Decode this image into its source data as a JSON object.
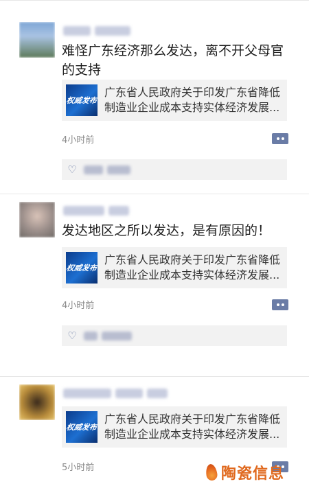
{
  "posts": [
    {
      "text": "难怪广东经济那么发达，离不开父母官的支持",
      "link": {
        "thumb_text": "权威发布",
        "title": "广东省人民政府关于印发广东省降低制造业企业成本支持实体经济发展..."
      },
      "time": "4小时前"
    },
    {
      "text": "发达地区之所以发达，是有原因的！",
      "link": {
        "thumb_text": "权威发布",
        "title": "广东省人民政府关于印发广东省降低制造业企业成本支持实体经济发展..."
      },
      "time": "4小时前"
    },
    {
      "text": "",
      "link": {
        "thumb_text": "权威发布",
        "title": "广东省人民政府关于印发广东省降低制造业企业成本支持实体经济发展..."
      },
      "time": "5小时前"
    }
  ],
  "watermark": "陶瓷信息",
  "colors": {
    "accent": "#6a7ca6",
    "card_bg": "#f2f2f2",
    "watermark": "#e0691e"
  },
  "icons": {
    "comment_button": "more-dots-icon",
    "like": "heart-icon"
  }
}
